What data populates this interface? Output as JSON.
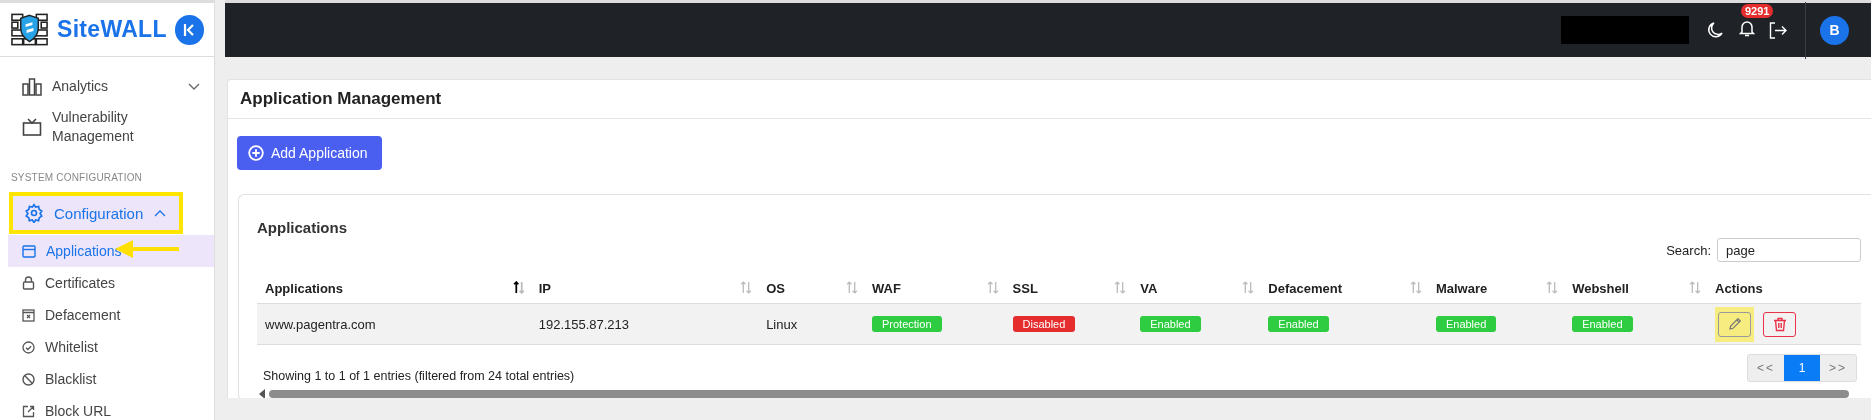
{
  "brand": {
    "name": "SiteWALL"
  },
  "topbar": {
    "notification_count": "9291",
    "avatar": "B"
  },
  "sidebar": {
    "items": [
      {
        "kind": "group",
        "label": "Analytics",
        "expanded": false
      },
      {
        "kind": "link",
        "label": "Vulnerability Management"
      },
      {
        "kind": "section",
        "label": "SYSTEM CONFIGURATION"
      },
      {
        "kind": "group",
        "label": "Configuration",
        "expanded": true,
        "highlighted": true,
        "children": [
          {
            "label": "Applications",
            "selected": true,
            "pointed": true
          },
          {
            "label": "Certificates",
            "selected": false,
            "pointed": false
          },
          {
            "label": "Defacement",
            "selected": false,
            "pointed": false
          },
          {
            "label": "Whitelist",
            "selected": false,
            "pointed": false
          },
          {
            "label": "Blacklist",
            "selected": false,
            "pointed": false
          },
          {
            "label": "Block URL",
            "selected": false,
            "pointed": false
          }
        ]
      }
    ]
  },
  "page": {
    "title": "Application Management",
    "add_button": "Add Application"
  },
  "table_card": {
    "title": "Applications",
    "search_label": "Search:",
    "search_value": "page",
    "columns": [
      {
        "label": "Applications",
        "sortable": true,
        "sorted": true
      },
      {
        "label": "IP",
        "sortable": true,
        "sorted": false
      },
      {
        "label": "OS",
        "sortable": true,
        "sorted": false
      },
      {
        "label": "WAF",
        "sortable": true,
        "sorted": false
      },
      {
        "label": "SSL",
        "sortable": true,
        "sorted": false
      },
      {
        "label": "VA",
        "sortable": true,
        "sorted": false
      },
      {
        "label": "Defacement",
        "sortable": true,
        "sorted": false
      },
      {
        "label": "Malware",
        "sortable": true,
        "sorted": false
      },
      {
        "label": "Webshell",
        "sortable": true,
        "sorted": false
      },
      {
        "label": "Actions"
      }
    ],
    "rows": [
      {
        "cells": [
          {
            "kind": "text",
            "text": "www.pagentra.com"
          },
          {
            "kind": "text",
            "text": "192.155.87.213"
          },
          {
            "kind": "text",
            "text": "Linux"
          },
          {
            "kind": "badge",
            "text": "Protection",
            "color": "#2ecc40"
          },
          {
            "kind": "badge",
            "text": "Disabled",
            "color": "#e52d2d"
          },
          {
            "kind": "badge",
            "text": "Enabled",
            "color": "#2ecc40"
          },
          {
            "kind": "badge",
            "text": "Enabled",
            "color": "#2ecc40"
          },
          {
            "kind": "badge",
            "text": "Enabled",
            "color": "#2ecc40"
          },
          {
            "kind": "badge",
            "text": "Enabled",
            "color": "#2ecc40"
          },
          {
            "kind": "actions",
            "actions": [
              {
                "kind": "edit",
                "highlighted": true
              },
              {
                "kind": "delete",
                "highlighted": false
              }
            ]
          }
        ]
      }
    ],
    "info": "Showing 1 to 1 of 1 entries (filtered from 24 total entries)",
    "pagination": [
      {
        "label": "<<",
        "selected": false
      },
      {
        "label": "1",
        "selected": true
      },
      {
        "label": ">>",
        "selected": false
      }
    ]
  }
}
